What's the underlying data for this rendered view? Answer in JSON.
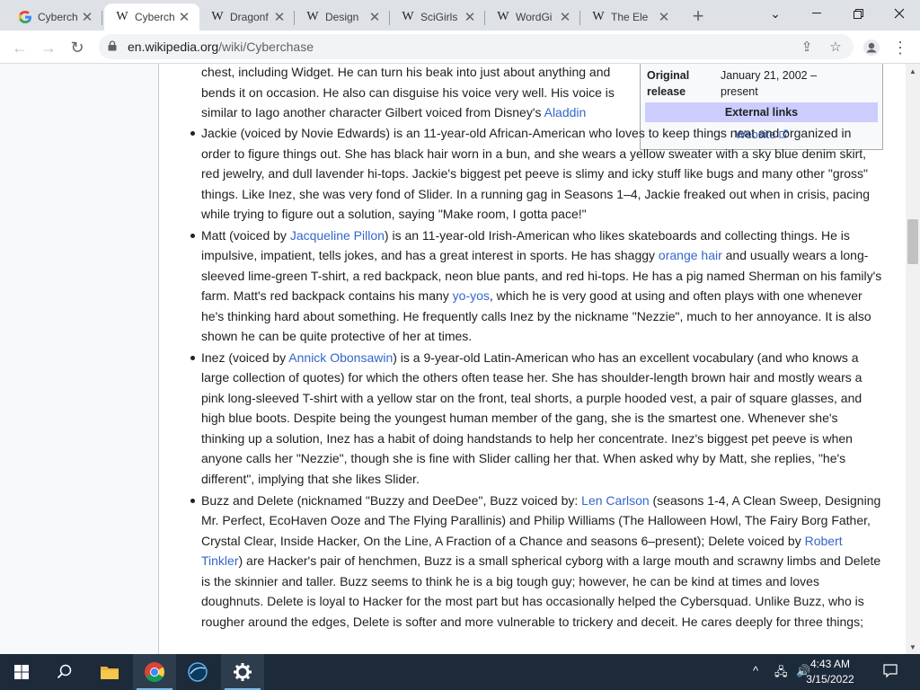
{
  "tabs": [
    {
      "favicon": "G",
      "title": "Cyberch",
      "active": false
    },
    {
      "favicon": "W",
      "title": "Cyberch",
      "active": true
    },
    {
      "favicon": "W",
      "title": "Dragonf",
      "active": false
    },
    {
      "favicon": "W",
      "title": "Design",
      "active": false
    },
    {
      "favicon": "W",
      "title": "SciGirls",
      "active": false
    },
    {
      "favicon": "W",
      "title": "WordGi",
      "active": false
    },
    {
      "favicon": "W",
      "title": "The Ele",
      "active": false
    }
  ],
  "address": {
    "host": "en.wikipedia.org",
    "path": "/wiki/Cyberchase"
  },
  "infobox": {
    "original_release_label": "Original release",
    "original_release_value": "January 21, 2002 – present",
    "external_links_header": "External links",
    "website_link": "Website"
  },
  "article": {
    "cont": {
      "t1": "chest, including Widget. He can turn his beak into just about anything and bends it on occasion. He also can disguise his voice very well. His voice is similar to Iago another character Gilbert voiced from Disney's ",
      "l1": "Aladdin"
    },
    "jackie": {
      "t1": "Jackie (voiced by Novie Edwards) is an 11-year-old African-American who loves to keep things neat and organized in order to figure things out. She has black hair worn in a bun, and she wears a yellow sweater with a sky blue denim skirt, red jewelry, and dull lavender hi-tops. Jackie's biggest pet peeve is slimy and icky stuff like bugs and many other \"gross\" things. Like Inez, she was very fond of Slider. In a running gag in Seasons 1–4, Jackie freaked out when in crisis, pacing while trying to figure out a solution, saying \"Make room, I gotta pace!\""
    },
    "matt": {
      "t1": "Matt (voiced by ",
      "l1": "Jacqueline Pillon",
      "t2": ") is an 11-year-old Irish-American who likes skateboards and collecting things. He is impulsive, impatient, tells jokes, and has a great interest in sports. He has shaggy ",
      "l2": "orange hair",
      "t3": " and usually wears a long-sleeved lime-green T-shirt, a red backpack, neon blue pants, and red hi-tops. He has a pig named Sherman on his family's farm. Matt's red backpack contains his many ",
      "l3": "yo-yos",
      "t4": ", which he is very good at using and often plays with one whenever he's thinking hard about something. He frequently calls Inez by the nickname \"Nezzie\", much to her annoyance. It is also shown he can be quite protective of her at times."
    },
    "inez": {
      "t1": "Inez (voiced by ",
      "l1": "Annick Obonsawin",
      "t2": ") is a 9-year-old Latin-American who has an excellent vocabulary (and who knows a large collection of quotes) for which the others often tease her. She has shoulder-length brown hair and mostly wears a pink long-sleeved T-shirt with a yellow star on the front, teal shorts, a purple hooded vest, a pair of square glasses, and high blue boots. Despite being the youngest human member of the gang, she is the smartest one. Whenever she's thinking up a solution, Inez has a habit of doing handstands to help her concentrate. Inez's biggest pet peeve is when anyone calls her \"Nezzie\", though she is fine with Slider calling her that. When asked why by Matt, she replies, \"he's different\", implying that she likes Slider."
    },
    "buzz": {
      "t1": "Buzz and Delete (nicknamed \"Buzzy and DeeDee\", Buzz voiced by: ",
      "l1": "Len Carlson",
      "t2": " (seasons 1-4, A Clean Sweep, Designing Mr. Perfect, EcoHaven Ooze and The Flying Parallinis) and Philip Williams (The Halloween Howl, The Fairy Borg Father, Crystal Clear, Inside Hacker, On the Line, A Fraction of a Chance and seasons 6–present); Delete voiced by ",
      "l2": "Robert Tinkler",
      "t3": ") are Hacker's pair of henchmen, Buzz is a small spherical cyborg with a large mouth and scrawny limbs and Delete is the skinnier and taller. Buzz seems to think he is a big tough guy; however, he can be kind at times and loves doughnuts. Delete is loyal to Hacker for the most part but has occasionally helped the Cybersquad. Unlike Buzz, who is rougher around the edges, Delete is softer and more vulnerable to trickery and deceit. He cares deeply for three things;"
    }
  },
  "taskbar": {
    "time": "4:43 AM",
    "date": "3/15/2022"
  },
  "colors": {
    "link": "#3366cc",
    "infobox_header": "#ccccff",
    "taskbar": "#1c2a3a"
  }
}
